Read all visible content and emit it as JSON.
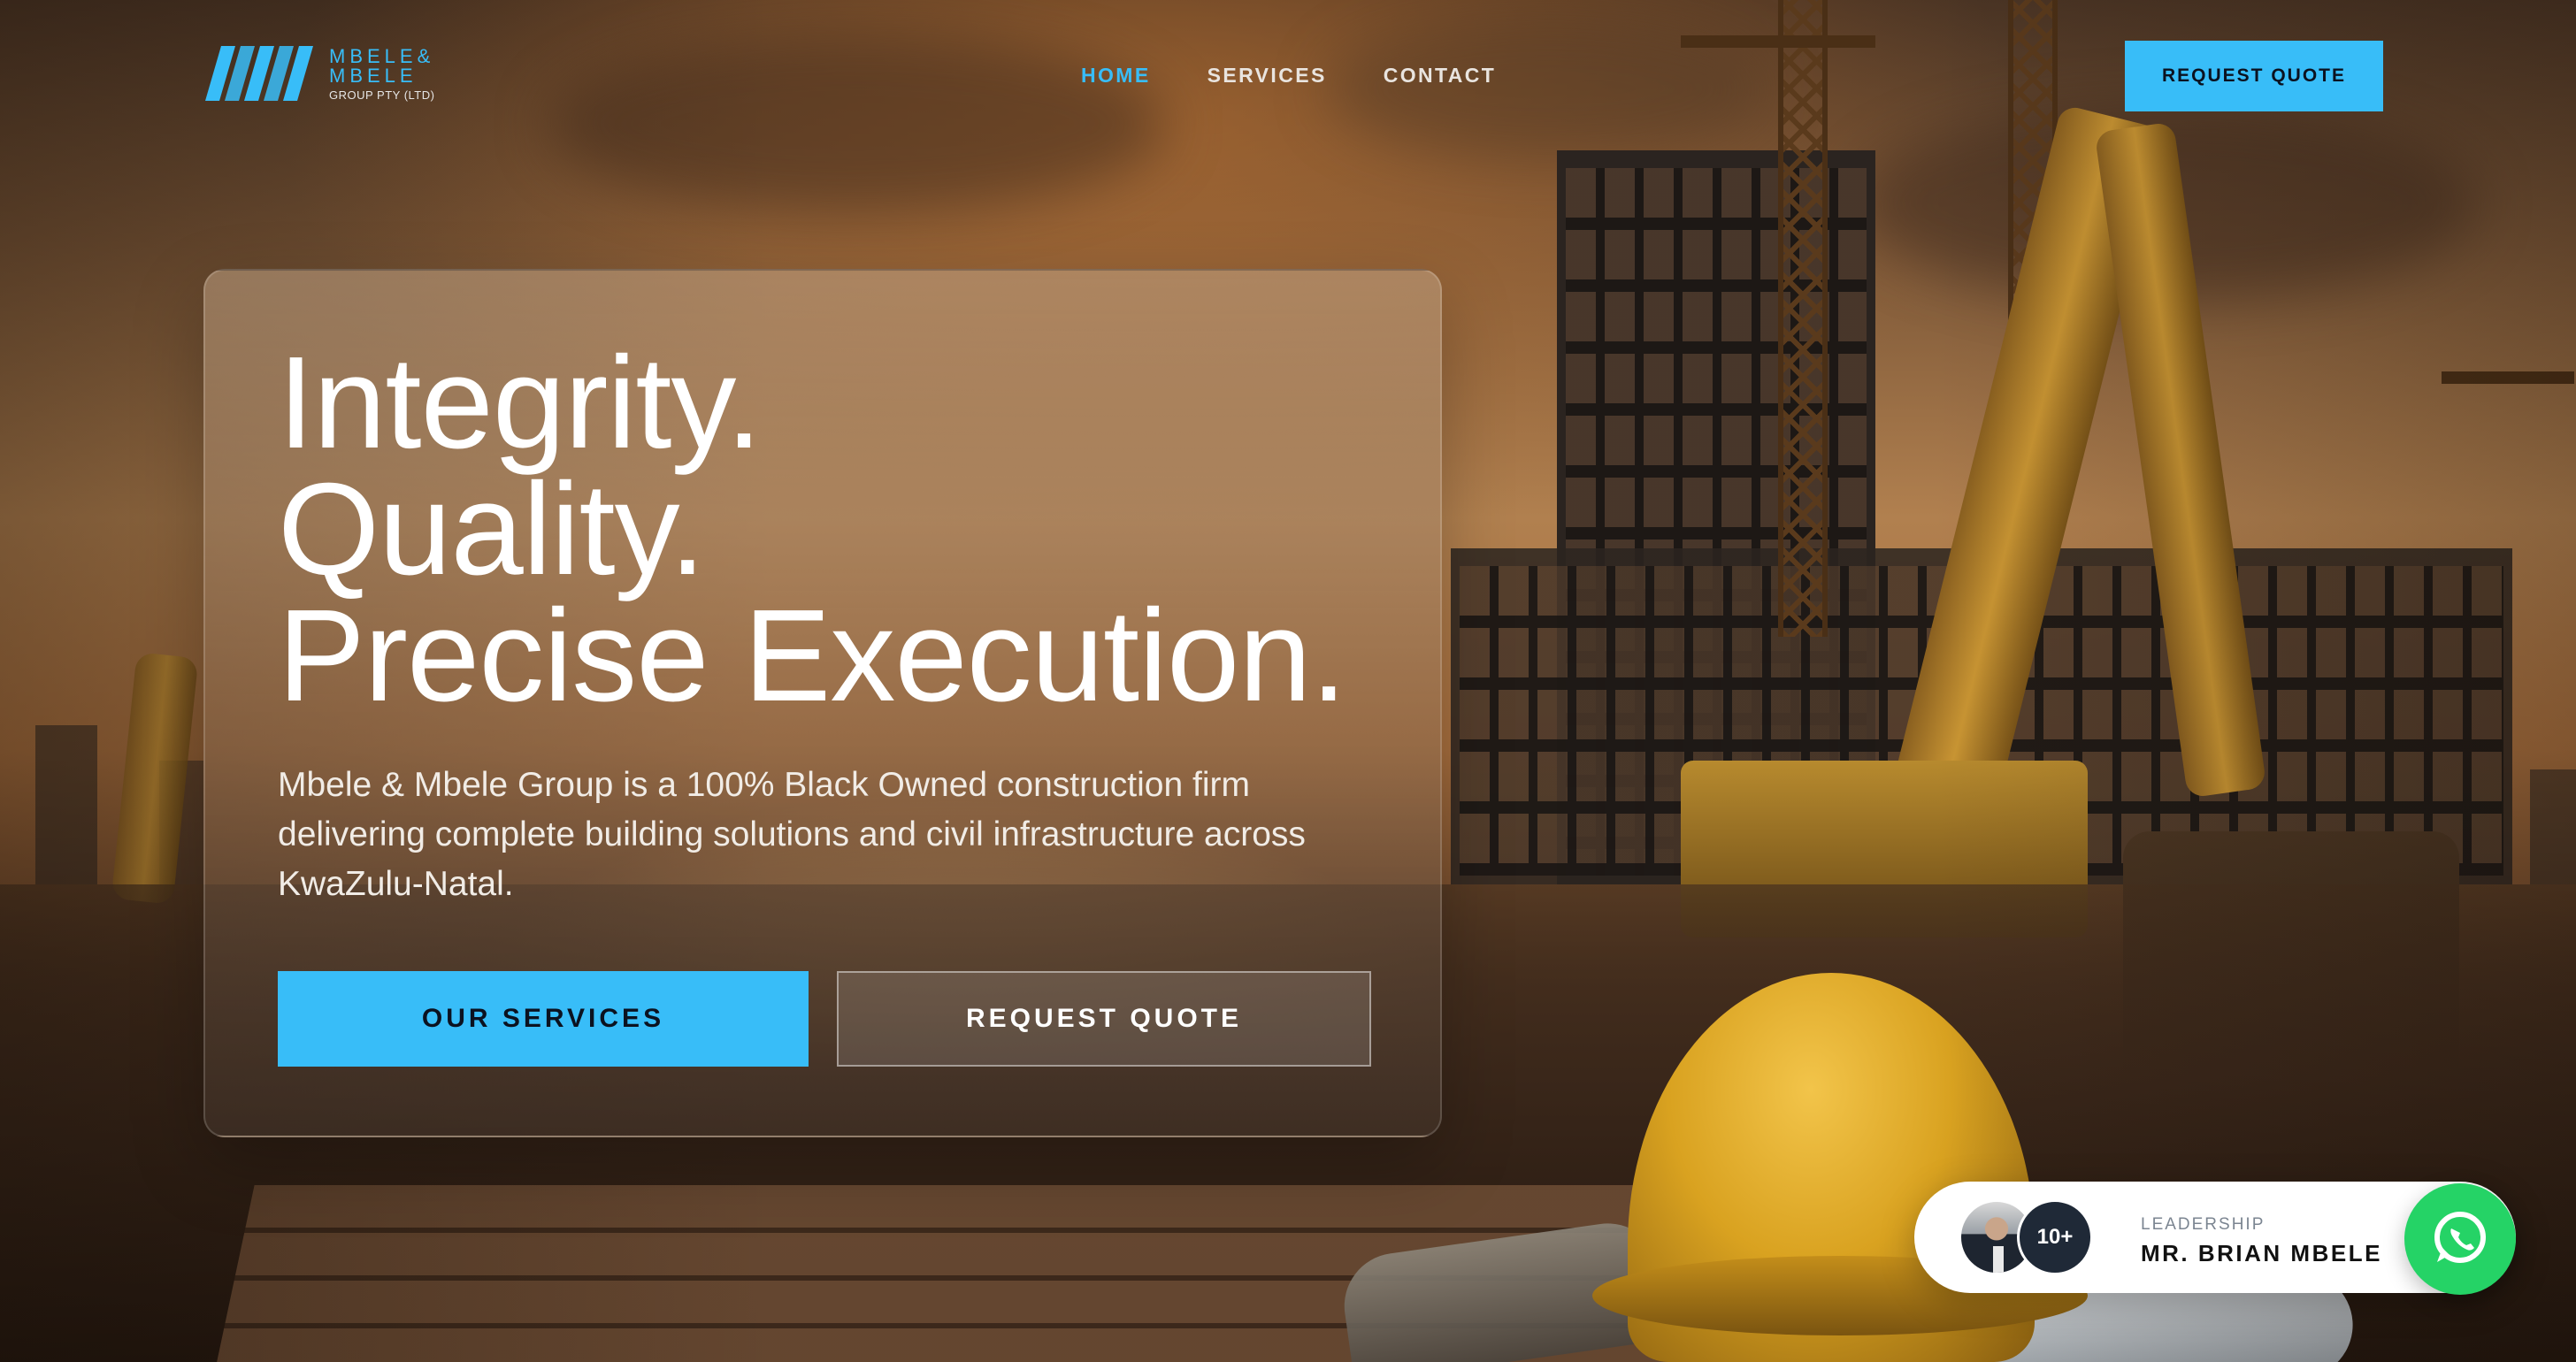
{
  "brand": {
    "name_line1": "MBELE&",
    "name_line2": "MBELE",
    "tagline": "GROUP PTY (LTD)",
    "accent_color": "#38bdf8"
  },
  "nav": {
    "items": [
      {
        "label": "HOME",
        "active": true
      },
      {
        "label": "SERVICES",
        "active": false
      },
      {
        "label": "CONTACT",
        "active": false
      }
    ]
  },
  "header": {
    "cta_label": "REQUEST QUOTE"
  },
  "hero": {
    "title_lines": [
      "Integrity.",
      "Quality.",
      "Precise Execution."
    ],
    "description": "Mbele & Mbele Group is a 100% Black Owned construction firm delivering complete building solutions and civil infrastructure across KwaZulu-Natal.",
    "primary_button": "OUR SERVICES",
    "secondary_button": "REQUEST QUOTE"
  },
  "leadership": {
    "badge": "10+",
    "label": "LEADERSHIP",
    "name": "MR. BRIAN MBELE",
    "avatar_icon": "person-portrait",
    "whatsapp_icon": "whatsapp-icon",
    "whatsapp_color": "#25d366"
  }
}
